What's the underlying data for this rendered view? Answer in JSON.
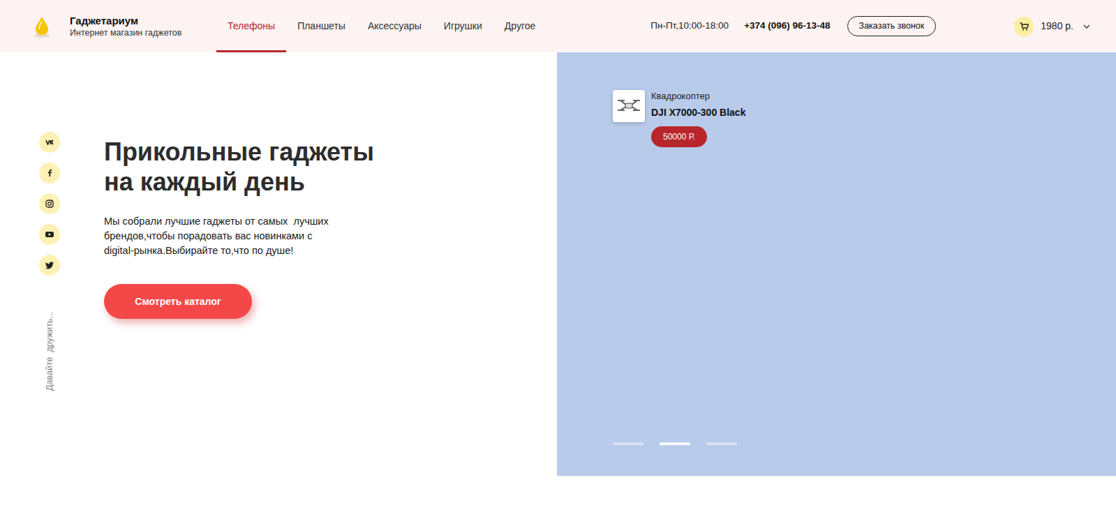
{
  "header": {
    "brand": {
      "name": "Гаджетариум",
      "tagline": "Интернет магазин гаджетов"
    },
    "nav": [
      {
        "label": "Телефоны",
        "selected": true
      },
      {
        "label": "Планшеты",
        "selected": false
      },
      {
        "label": "Аксессуары",
        "selected": false
      },
      {
        "label": "Игрушки",
        "selected": false
      },
      {
        "label": "Другое",
        "selected": false
      }
    ],
    "hours": "Пн-Пт,10:00-18:00",
    "phone": "+374 (096) 96-13-48",
    "callback_button": "Заказать звонок",
    "cart": {
      "total": "1980 р."
    }
  },
  "social": {
    "caption": "Давайте  дружить...",
    "links": [
      {
        "kind": "vk"
      },
      {
        "kind": "facebook"
      },
      {
        "kind": "instagram"
      },
      {
        "kind": "youtube"
      },
      {
        "kind": "twitter"
      }
    ]
  },
  "hero": {
    "title": [
      "Прикольные гаджеты",
      "на каждый день"
    ],
    "text": [
      "Мы собрали лучшие гаджеты от самых  лучших",
      "брендов,чтобы порадовать вас новинками с",
      "digital-рынка.Выбирайте то,что по душе!"
    ],
    "button": "Смотреть каталог"
  },
  "slide": {
    "category": "Квадрокоптер",
    "product": "DJI X7000-300 Black",
    "price": "50000 Р.",
    "dots": [
      {
        "selected": false
      },
      {
        "selected": true
      },
      {
        "selected": false
      }
    ]
  }
}
